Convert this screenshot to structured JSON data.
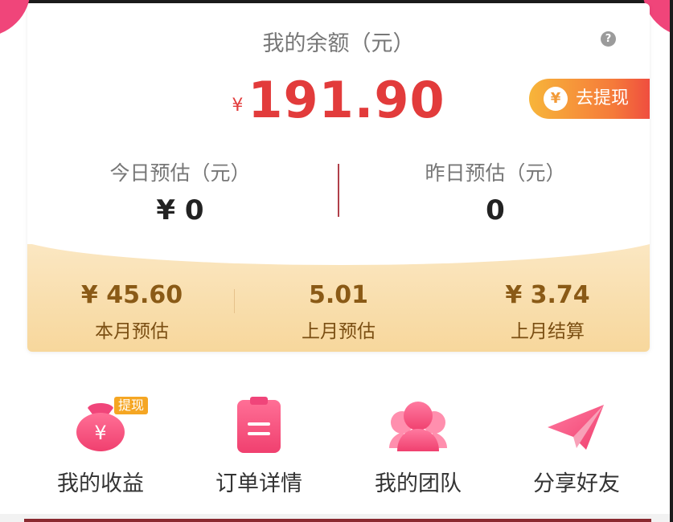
{
  "balance_card": {
    "title": "我的余额（元）",
    "help_icon": "?",
    "currency": "¥",
    "amount": "191.90",
    "withdraw": {
      "icon": "¥",
      "label": "去提现"
    },
    "today": {
      "label": "今日预估（元）",
      "value": "¥ 0"
    },
    "yesterday": {
      "label": "昨日预估（元）",
      "value": "0"
    },
    "summary": [
      {
        "value": "¥ 45.60",
        "label": "本月预估"
      },
      {
        "value": "5.01",
        "label": "上月预估"
      },
      {
        "value": "¥ 3.74",
        "label": "上月结算"
      }
    ]
  },
  "menu": [
    {
      "label": "我的收益",
      "icon": "money-bag-icon",
      "badge": "提现",
      "icon_glyph": "¥"
    },
    {
      "label": "订单详情",
      "icon": "clipboard-icon"
    },
    {
      "label": "我的团队",
      "icon": "team-icon"
    },
    {
      "label": "分享好友",
      "icon": "paper-plane-icon"
    }
  ],
  "colors": {
    "brand_pink": "#f0457a",
    "amount_red": "#e23b3b",
    "gold_text": "#8a5a16",
    "withdraw_start": "#f7b53a",
    "withdraw_end": "#ef4e3f"
  }
}
